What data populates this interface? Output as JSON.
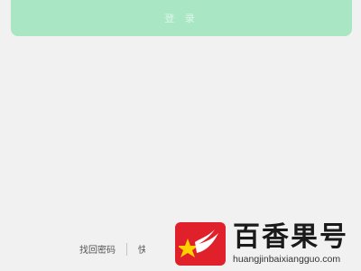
{
  "login": {
    "button_label": "登 录"
  },
  "footer_links": {
    "forgot_password": "找回密码",
    "partial_link": "快速注册"
  },
  "watermark": {
    "name": "百香果号",
    "url": "huangjinbaixiangguo.com",
    "logo_color": "#e0202a"
  },
  "colors": {
    "background": "#f1f1f1",
    "button": "#a8e6c4"
  }
}
